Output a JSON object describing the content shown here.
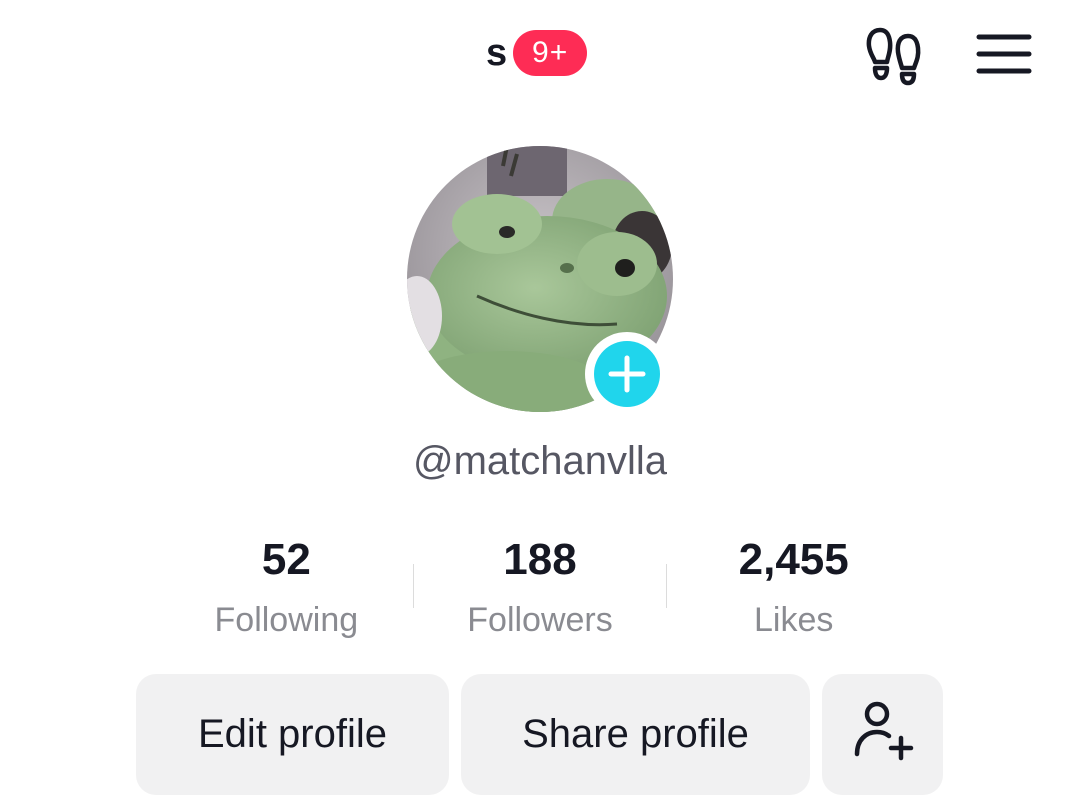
{
  "header": {
    "account_name": "s",
    "notification_badge": "9+",
    "badge_color": "#fe2c55",
    "footprints_icon": "footprints-icon",
    "menu_icon": "hamburger-menu-icon"
  },
  "profile": {
    "avatar_description": "avatar",
    "add_avatar_icon": "plus-icon",
    "add_avatar_color": "#20d5ec",
    "username": "@matchanvlla"
  },
  "stats": [
    {
      "value": "52",
      "label": "Following"
    },
    {
      "value": "188",
      "label": "Followers"
    },
    {
      "value": "2,455",
      "label": "Likes"
    }
  ],
  "actions": {
    "edit_label": "Edit profile",
    "share_label": "Share profile",
    "add_friend_icon": "add-friend-icon"
  }
}
